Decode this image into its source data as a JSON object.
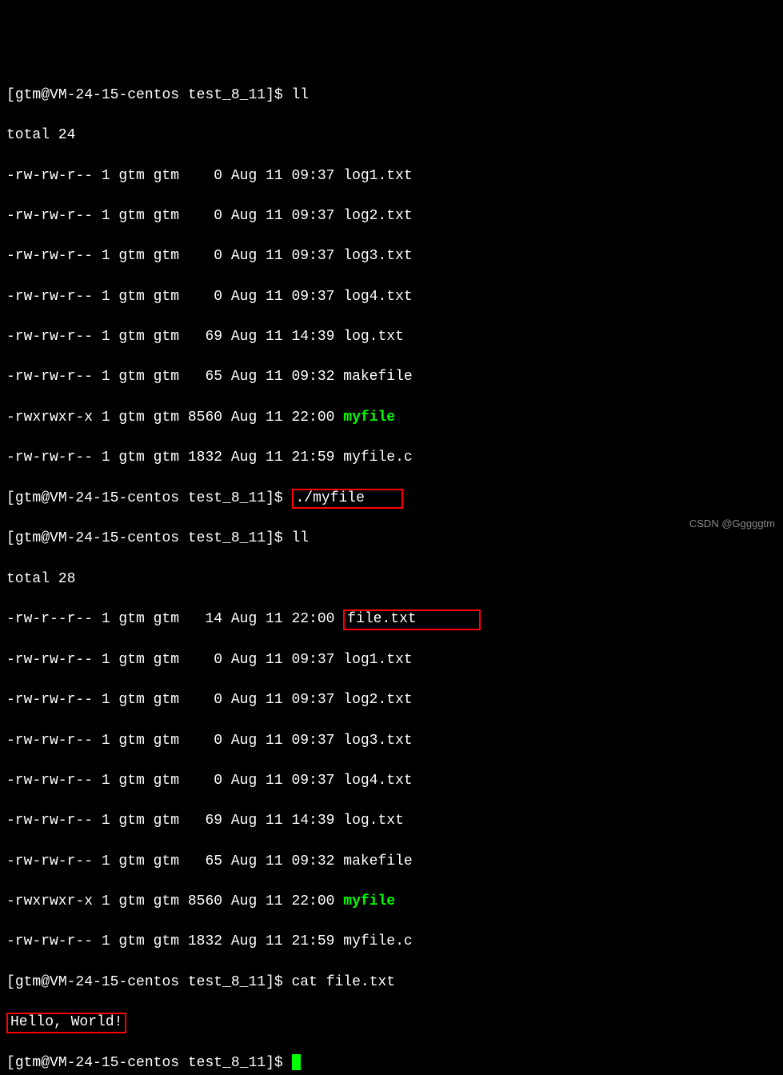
{
  "prompt": {
    "user": "gtm",
    "at": "@",
    "host": "VM-24-15-centos",
    "dir": "test_8_11",
    "open": "[",
    "close": "]$ "
  },
  "commands": {
    "ll1": "ll",
    "runfile": "./myfile",
    "ll2": "ll",
    "cat": "cat file.txt",
    "empty": ""
  },
  "totals": {
    "t1": "total 24",
    "t2": "total 28"
  },
  "list1": {
    "r1": {
      "perm": "-rw-rw-r-- 1 gtm gtm    0 Aug 11 09:37 ",
      "name": "log1.txt"
    },
    "r2": {
      "perm": "-rw-rw-r-- 1 gtm gtm    0 Aug 11 09:37 ",
      "name": "log2.txt"
    },
    "r3": {
      "perm": "-rw-rw-r-- 1 gtm gtm    0 Aug 11 09:37 ",
      "name": "log3.txt"
    },
    "r4": {
      "perm": "-rw-rw-r-- 1 gtm gtm    0 Aug 11 09:37 ",
      "name": "log4.txt"
    },
    "r5": {
      "perm": "-rw-rw-r-- 1 gtm gtm   69 Aug 11 14:39 ",
      "name": "log.txt"
    },
    "r6": {
      "perm": "-rw-rw-r-- 1 gtm gtm   65 Aug 11 09:32 ",
      "name": "makefile"
    },
    "r7": {
      "perm": "-rwxrwxr-x 1 gtm gtm 8560 Aug 11 22:00 ",
      "name": "myfile"
    },
    "r8": {
      "perm": "-rw-rw-r-- 1 gtm gtm 1832 Aug 11 21:59 ",
      "name": "myfile.c"
    }
  },
  "list2": {
    "r0": {
      "perm": "-rw-r--r-- 1 gtm gtm   14 Aug 11 22:00 ",
      "name": "file.txt"
    },
    "r1": {
      "perm": "-rw-rw-r-- 1 gtm gtm    0 Aug 11 09:37 ",
      "name": "log1.txt"
    },
    "r2": {
      "perm": "-rw-rw-r-- 1 gtm gtm    0 Aug 11 09:37 ",
      "name": "log2.txt"
    },
    "r3": {
      "perm": "-rw-rw-r-- 1 gtm gtm    0 Aug 11 09:37 ",
      "name": "log3.txt"
    },
    "r4": {
      "perm": "-rw-rw-r-- 1 gtm gtm    0 Aug 11 09:37 ",
      "name": "log4.txt"
    },
    "r5": {
      "perm": "-rw-rw-r-- 1 gtm gtm   69 Aug 11 14:39 ",
      "name": "log.txt"
    },
    "r6": {
      "perm": "-rw-rw-r-- 1 gtm gtm   65 Aug 11 09:32 ",
      "name": "makefile"
    },
    "r7": {
      "perm": "-rwxrwxr-x 1 gtm gtm 8560 Aug 11 22:00 ",
      "name": "myfile"
    },
    "r8": {
      "perm": "-rw-rw-r-- 1 gtm gtm 1832 Aug 11 21:59 ",
      "name": "myfile.c"
    }
  },
  "cat_output": "Hello, World!",
  "watermark": "CSDN @Gggggtm"
}
